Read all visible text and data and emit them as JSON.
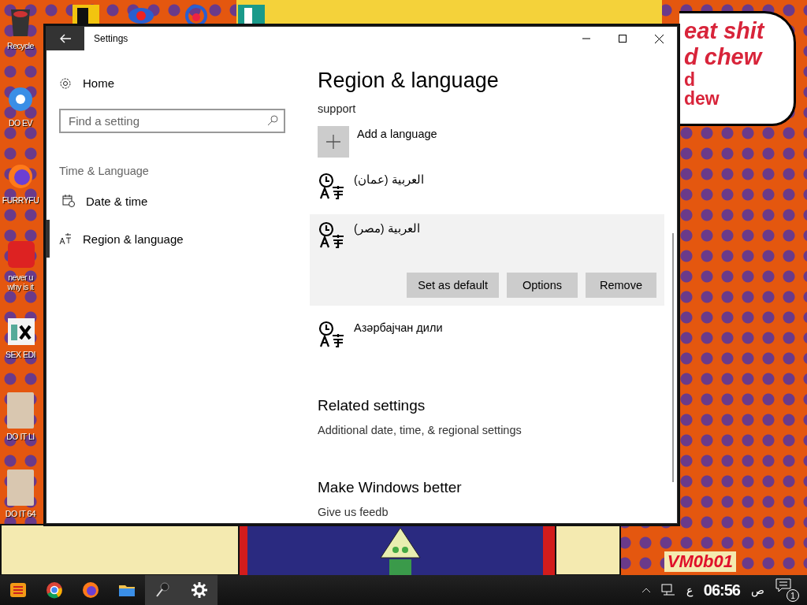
{
  "desktop": {
    "icons": [
      {
        "label": "Recycle",
        "kind": "bin"
      },
      {
        "label": "DO EV",
        "kind": "chrome"
      },
      {
        "label": "FURRYFU",
        "kind": "firefox"
      },
      {
        "label": "never u\nwhy is it",
        "kind": "dev"
      },
      {
        "label": "SEX EDI",
        "kind": "hex"
      },
      {
        "label": "DO IT LI",
        "kind": "portrait"
      },
      {
        "label": "DO IT 64",
        "kind": "portrait"
      }
    ],
    "speech_bubble": {
      "lines": [
        "eat shit",
        "d chew",
        "d",
        "dew"
      ]
    },
    "wallpaper_text": "VM0b01"
  },
  "window": {
    "title": "Settings",
    "sidebar": {
      "home": "Home",
      "search": {
        "placeholder": "Find a setting"
      },
      "section": "Time & Language",
      "items": [
        {
          "label": "Date & time",
          "kind": "calendar",
          "selected": false
        },
        {
          "label": "Region & language",
          "kind": "region",
          "selected": true
        }
      ]
    },
    "content": {
      "heading": "Region & language",
      "intro": "support",
      "add_language": "Add a language",
      "languages": [
        {
          "name": "العربية (عمان)",
          "expanded": false
        },
        {
          "name": "العربية (مصر)",
          "expanded": true,
          "buttons": [
            "Set as default",
            "Options",
            "Remove"
          ]
        },
        {
          "name": "Азәрбајчан дили",
          "expanded": false
        }
      ],
      "related": {
        "heading": "Related settings",
        "link": "Additional date, time, & regional settings"
      },
      "feedback": {
        "heading": "Make Windows better",
        "link": "Give us feedb"
      }
    }
  },
  "taskbar": {
    "apps": [
      {
        "kind": "start",
        "active": false
      },
      {
        "kind": "chrome",
        "active": false
      },
      {
        "kind": "firefox",
        "active": false
      },
      {
        "kind": "folder",
        "active": false
      },
      {
        "kind": "tool",
        "active": true
      },
      {
        "kind": "settings",
        "active": true
      }
    ],
    "input_indicator": "ع",
    "time": "06:56",
    "period": "ص",
    "notifications": "1"
  }
}
